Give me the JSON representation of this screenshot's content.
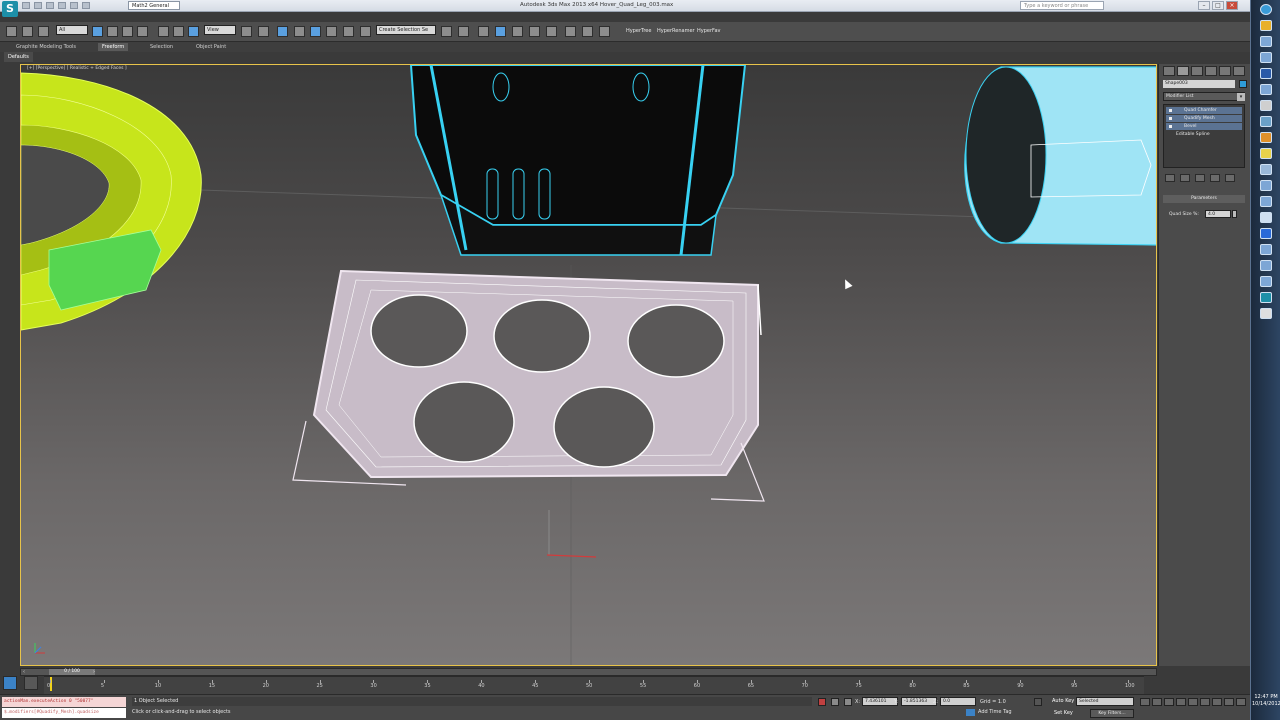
{
  "titlebar": {
    "logo": "S",
    "workspace": "Math2 General",
    "title": "Autodesk 3ds Max 2013 x64    Hover_Quad_Leg_003.max",
    "search_placeholder": "Type a keyword or phrase"
  },
  "toolbar": {
    "filter": "All",
    "view_select": "View",
    "selection_set": "Create Selection Se",
    "plugins": [
      "HyperTree",
      "HyperRenamer",
      "HyperFav"
    ]
  },
  "ribbon": {
    "tabs": [
      "Graphite Modeling Tools",
      "Freeform",
      "Selection",
      "Object Paint"
    ],
    "active_tab": "Freeform",
    "defaults_label": "Defaults"
  },
  "viewport": {
    "label": "[+] [Perspective] [ Realistic + Edged Faces ]"
  },
  "command_panel": {
    "object_name": "Shape003",
    "object_color": "#2e9cd8",
    "modifier_list": "Modifier List",
    "stack": [
      "Quad Chamfer",
      "Quadify Mesh",
      "Bevel",
      "Editable Spline"
    ],
    "rollout_title": "Parameters",
    "param_label": "Quad Size %:",
    "param_value": "4.0"
  },
  "timeslider": {
    "value": "0 / 100",
    "ticks": [
      "0",
      "5",
      "10",
      "15",
      "20",
      "25",
      "30",
      "35",
      "40",
      "45",
      "50",
      "55",
      "60",
      "65",
      "70",
      "75",
      "80",
      "85",
      "90",
      "95",
      "100"
    ]
  },
  "statusbar": {
    "maxscript_line1": "actionMan.executeAction 0 \"50077\"",
    "maxscript_line2": "$.modifiers[#Quadify_Mesh].quadsize",
    "selection_count": "1 Object Selected",
    "prompt": "Click or click-and-drag to select objects",
    "x_label": "X:",
    "x_value": "7.436101",
    "y_label": "Y:",
    "y_value": "-1.851363",
    "z_label": "Z:",
    "z_value": "0.0",
    "grid": "Grid = 1.0",
    "time_tag": "Add Time Tag",
    "auto_key": "Auto Key",
    "set_key": "Set Key",
    "key_mode": "Selected",
    "key_filters": "Key Filters..."
  },
  "taskbar": {
    "time": "12:47 PM",
    "date": "10/14/2012"
  },
  "colors": {
    "viewport_border": "#e7c34a",
    "wire_white": "#f0e6f0",
    "wire_cyan": "#38d1f2",
    "wire_yellow": "#d4f21d",
    "wire_green": "#59e05a"
  }
}
